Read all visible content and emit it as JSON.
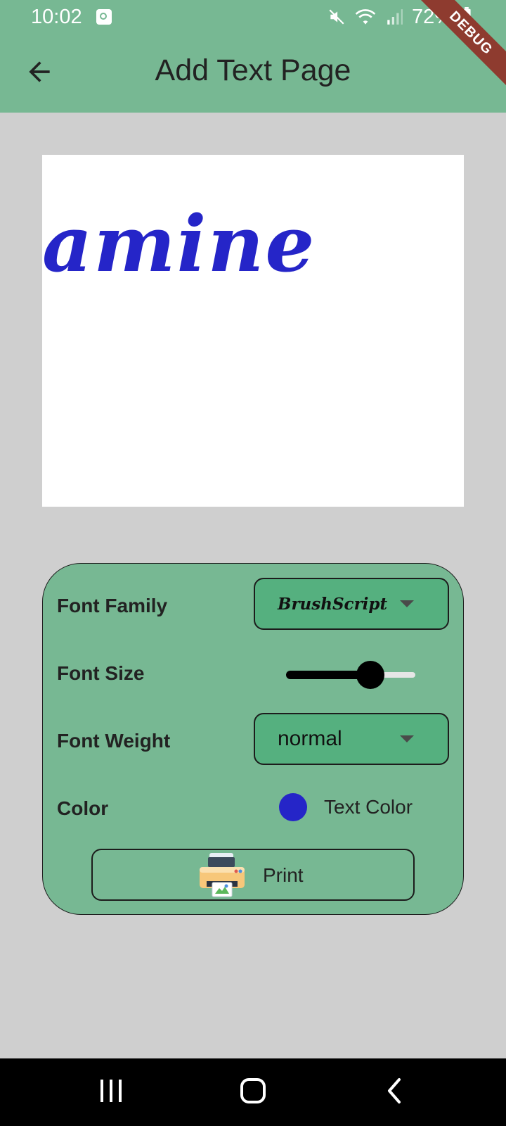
{
  "status_bar": {
    "time": "10:02",
    "battery": "72%",
    "debug_banner": "DEBUG"
  },
  "app_bar": {
    "title": "Add Text Page",
    "back_icon": "arrow-back-icon"
  },
  "canvas": {
    "text": "amine",
    "text_color": "#2525c8"
  },
  "controls": {
    "font_family": {
      "label": "Font Family",
      "selected": "BrushScript"
    },
    "font_size": {
      "label": "Font Size",
      "fraction": 0.65
    },
    "font_weight": {
      "label": "Font Weight",
      "selected": "normal"
    },
    "color": {
      "label": "Color",
      "button_label": "Text Color",
      "swatch": "#2525c8"
    },
    "print": {
      "label": "Print",
      "icon": "printer-icon"
    }
  },
  "colors": {
    "accent": "#77b893",
    "dropdown_bg": "#55b07f",
    "page_bg": "#cfcfcf"
  },
  "nav_bar": {
    "recents_icon": "recents-icon",
    "home_icon": "home-icon",
    "back_icon": "nav-back-icon"
  }
}
